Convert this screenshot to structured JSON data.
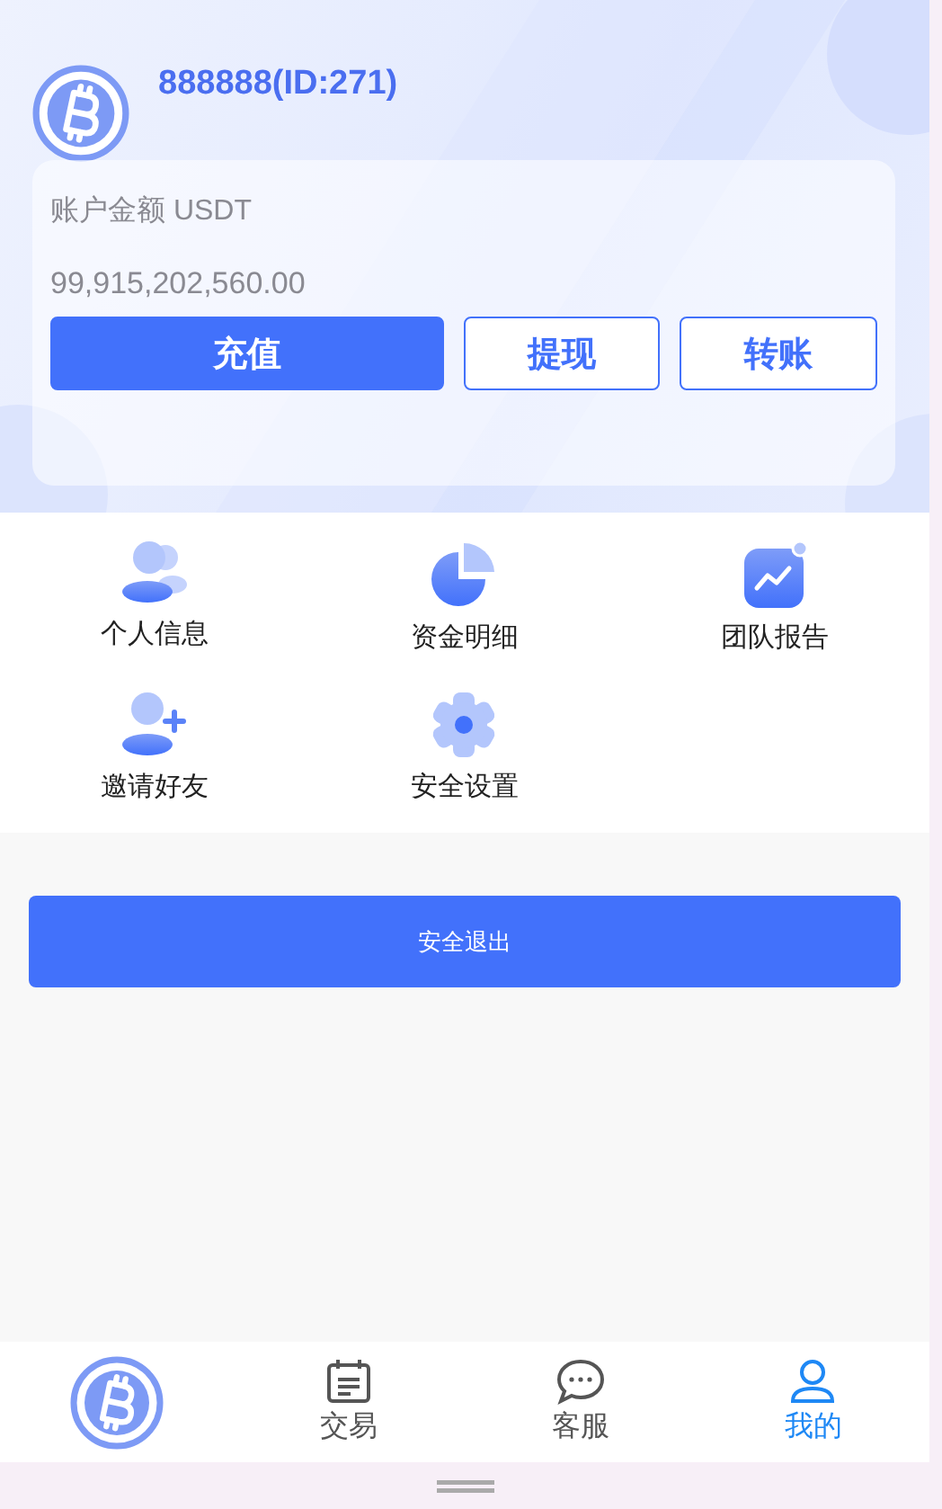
{
  "profile": {
    "name": "888888(ID:271)"
  },
  "account": {
    "label": "账户金额 USDT",
    "amount": "99,915,202,560.00",
    "buttons": [
      {
        "label": "充值",
        "kind": "primary"
      },
      {
        "label": "提现",
        "kind": "outline"
      },
      {
        "label": "转账",
        "kind": "outline"
      }
    ]
  },
  "menu": [
    {
      "label": "个人信息",
      "kind": "users"
    },
    {
      "label": "资金明细",
      "kind": "pie"
    },
    {
      "label": "团队报告",
      "kind": "chart"
    },
    {
      "label": "邀请好友",
      "kind": "invite"
    },
    {
      "label": "安全设置",
      "kind": "gear"
    }
  ],
  "logout": {
    "label": "安全退出"
  },
  "tabs": [
    {
      "kind": "logo",
      "selected": false
    },
    {
      "kind": "calendar",
      "label": "交易",
      "selected": false
    },
    {
      "kind": "chat",
      "label": "客服",
      "selected": false
    },
    {
      "kind": "user",
      "label": "我的",
      "selected": true
    }
  ]
}
